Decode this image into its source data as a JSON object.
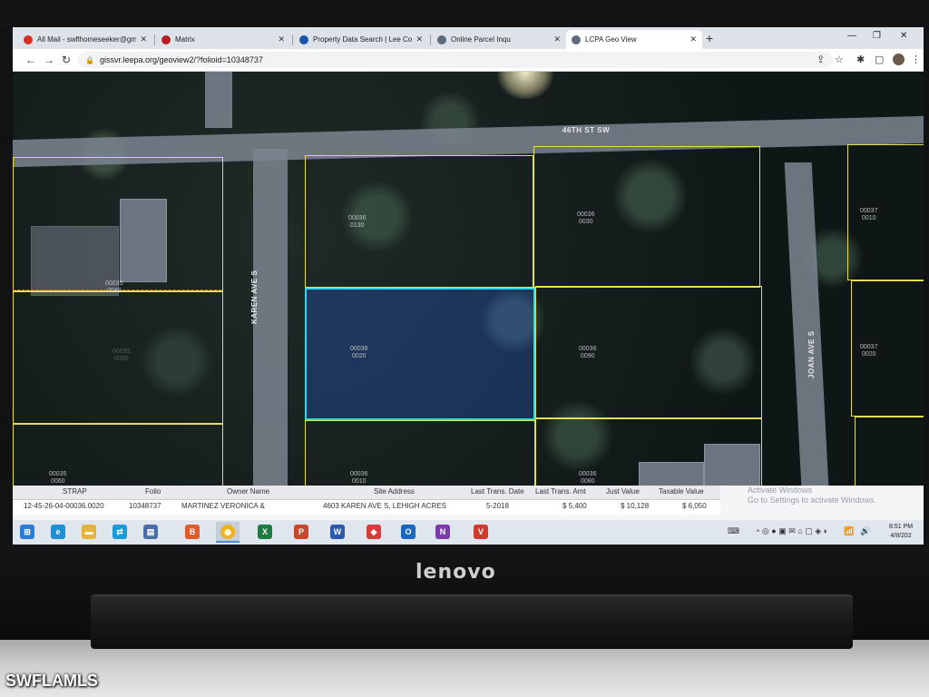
{
  "browser": {
    "tabs": [
      {
        "label": "All Mail - swflhomeseeker@gmai",
        "color": "#d93025"
      },
      {
        "label": "Matrix",
        "color": "#b71c1c"
      },
      {
        "label": "Property Data Search | Lee Count",
        "color": "#1a56a7"
      },
      {
        "label": "Online Parcel Inqu",
        "color": "#5f6b7a"
      },
      {
        "label": "LCPA Geo View",
        "color": "#5f6b7a"
      }
    ],
    "url": "gissvr.leepa.org/geoview2/?folioid=10348737"
  },
  "map": {
    "street_top": "46TH ST SW",
    "street_left": "KAREN AVE S",
    "street_right": "JOAN AVE S",
    "parcels": [
      {
        "line1": "00036",
        "line2": "0130"
      },
      {
        "line1": "00036",
        "line2": "0030"
      },
      {
        "line1": "00036",
        "line2": "0020"
      },
      {
        "line1": "00036",
        "line2": "0010"
      },
      {
        "line1": "00035",
        "line2": "0040"
      },
      {
        "line1": "00035",
        "line2": "0050"
      },
      {
        "line1": "00035",
        "line2": "0060"
      },
      {
        "line1": "00037",
        "line2": "0020"
      },
      {
        "line1": "00037",
        "line2": "0010"
      },
      {
        "line1": "00036",
        "line2": "0080"
      },
      {
        "line1": "00036",
        "line2": "0090"
      }
    ]
  },
  "table": {
    "headers": [
      "STRAP",
      "Folio",
      "Owner Name",
      "Site Address",
      "Last Trans. Date",
      "Last Trans. Amt",
      "Just Value",
      "Taxable Value"
    ],
    "row": [
      "12-45-26-04-00036.0020",
      "10348737",
      "MARTINEZ VERONICA &",
      "4603 KAREN AVE S, LEHIGH ACRES",
      "5-2018",
      "$ 5,400",
      "$ 10,128",
      "$ 6,050"
    ]
  },
  "activate": {
    "line1": "Activate Windows",
    "line2": "Go to Settings to activate Windows."
  },
  "taskbar": {
    "time": "8:51 PM",
    "date": "4/8/202"
  },
  "device": {
    "brand": "lenovo",
    "watermark": "SWFLAMLS"
  }
}
